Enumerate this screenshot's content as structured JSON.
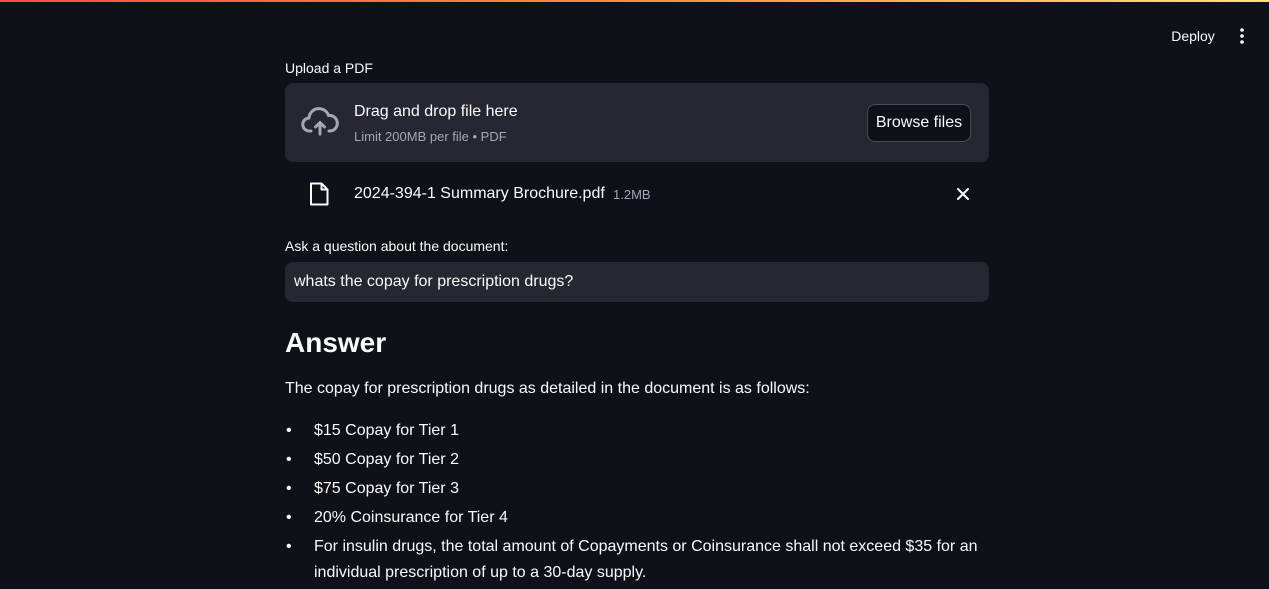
{
  "header": {
    "deploy_label": "Deploy",
    "menu_icon": "more-vertical-icon",
    "accent_gradient": [
      "#ff4b4b",
      "#ff8c3a",
      "#ffe66a"
    ]
  },
  "uploader": {
    "label": "Upload a PDF",
    "icon": "cloud-upload-icon",
    "title": "Drag and drop file here",
    "limit": "Limit 200MB per file • PDF",
    "browse_label": "Browse files"
  },
  "uploaded_file": {
    "icon": "file-icon",
    "name": "2024-394-1 Summary Brochure.pdf",
    "size": "1.2MB",
    "remove_icon": "close-icon"
  },
  "question": {
    "label": "Ask a question about the document:",
    "value": "whats the copay for prescription drugs?"
  },
  "answer": {
    "heading": "Answer",
    "intro": "The copay for prescription drugs as detailed in the document is as follows:",
    "items": [
      "$15 Copay for Tier 1",
      "$50 Copay for Tier 2",
      "$75 Copay for Tier 3",
      "20% Coinsurance for Tier 4",
      "For insulin drugs, the total amount of Copayments or Coinsurance shall not exceed $35 for an individual prescription of up to a 30-day supply."
    ]
  }
}
